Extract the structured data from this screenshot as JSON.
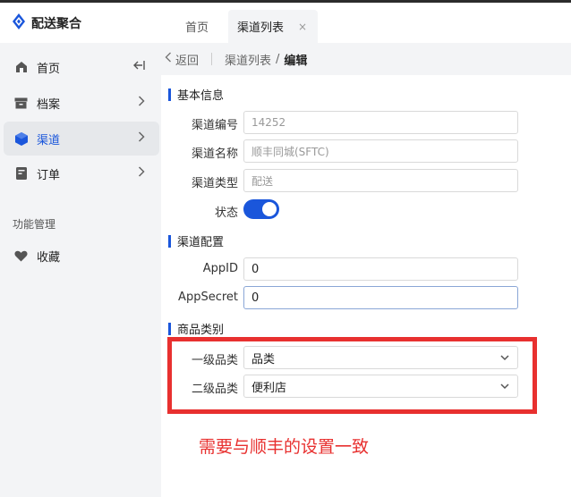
{
  "app": {
    "title": "配送聚合"
  },
  "tabs": [
    {
      "label": "首页"
    },
    {
      "label": "渠道列表",
      "close": "×"
    }
  ],
  "sidebar": {
    "items": [
      {
        "label": "首页"
      },
      {
        "label": "档案"
      },
      {
        "label": "渠道"
      },
      {
        "label": "订单"
      }
    ],
    "section": "功能管理",
    "extra": {
      "label": "收藏"
    }
  },
  "breadcrumb": {
    "back": "返回",
    "parent": "渠道列表",
    "sep": "/",
    "current": "编辑"
  },
  "sections": {
    "basic": "基本信息",
    "config": "渠道配置",
    "category": "商品类别"
  },
  "fields": {
    "code": {
      "label": "渠道编号",
      "value": "14252"
    },
    "name": {
      "label": "渠道名称",
      "value": "顺丰同城(SFTC)"
    },
    "type": {
      "label": "渠道类型",
      "value": "配送"
    },
    "status": {
      "label": "状态",
      "on": true
    },
    "appid": {
      "label": "AppID",
      "value": "0"
    },
    "appsecret": {
      "label": "AppSecret",
      "value": "0"
    },
    "cat1": {
      "label": "一级品类",
      "value": "品类"
    },
    "cat2": {
      "label": "二级品类",
      "value": "便利店"
    }
  },
  "annotation": {
    "text": "需要与顺丰的设置一致",
    "color": "#e8302f"
  },
  "colors": {
    "accent": "#1a56db",
    "sidebar_bg": "#f3f4f6"
  }
}
